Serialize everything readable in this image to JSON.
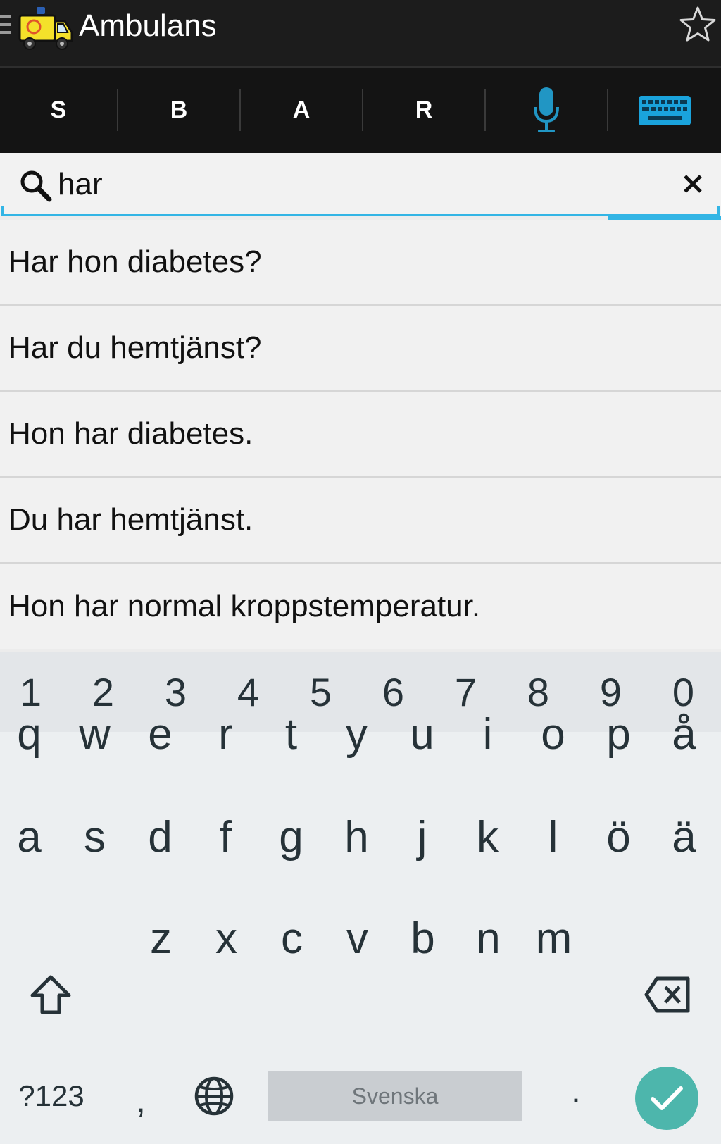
{
  "appbar": {
    "title": "Ambulans"
  },
  "tabs": {
    "items": [
      {
        "label": "S"
      },
      {
        "label": "B"
      },
      {
        "label": "A"
      },
      {
        "label": "R"
      }
    ],
    "accent_color": "#33b5e5"
  },
  "search": {
    "value": "har"
  },
  "results": [
    "Har hon diabetes?",
    "Har du hemtjänst?",
    "Hon har diabetes.",
    "Du har hemtjänst.",
    "Hon har normal kroppstemperatur."
  ],
  "keyboard": {
    "numbers": [
      "1",
      "2",
      "3",
      "4",
      "5",
      "6",
      "7",
      "8",
      "9",
      "0"
    ],
    "row1": [
      "q",
      "w",
      "e",
      "r",
      "t",
      "y",
      "u",
      "i",
      "o",
      "p",
      "å"
    ],
    "row2": [
      "a",
      "s",
      "d",
      "f",
      "g",
      "h",
      "j",
      "k",
      "l",
      "ö",
      "ä"
    ],
    "row3": [
      "z",
      "x",
      "c",
      "v",
      "b",
      "n",
      "m"
    ],
    "symbols_label": "?123",
    "comma": ",",
    "period": ".",
    "space_label": "Svenska",
    "enter_color": "#4db6ac"
  }
}
